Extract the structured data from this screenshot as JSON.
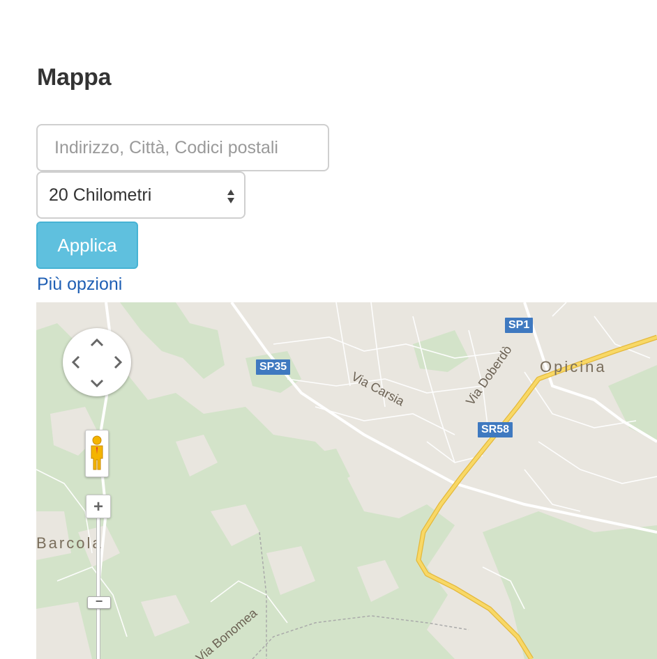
{
  "page": {
    "title": "Mappa"
  },
  "search": {
    "placeholder": "Indirizzo, Città, Codici postali"
  },
  "distance": {
    "selected": "20 Chilometri"
  },
  "actions": {
    "apply_label": "Applica",
    "more_options_label": "Più opzioni"
  },
  "map": {
    "places": {
      "opicina": "Opicina",
      "barcola": "Barcola"
    },
    "road_shields": {
      "sp1": "SP1",
      "sp35": "SP35",
      "sr58": "SR58"
    },
    "streets": {
      "via_carsia": "Via Carsia",
      "via_doberdo": "Via Doberdò",
      "via_bonomea": "Via Bonomea"
    },
    "controls": {
      "zoom_in": "+",
      "zoom_out": "−"
    },
    "colors": {
      "land": "#e9e6df",
      "park": "#cfe2c6",
      "highway": "#f6cf4f",
      "shield": "#3f79c0"
    }
  }
}
